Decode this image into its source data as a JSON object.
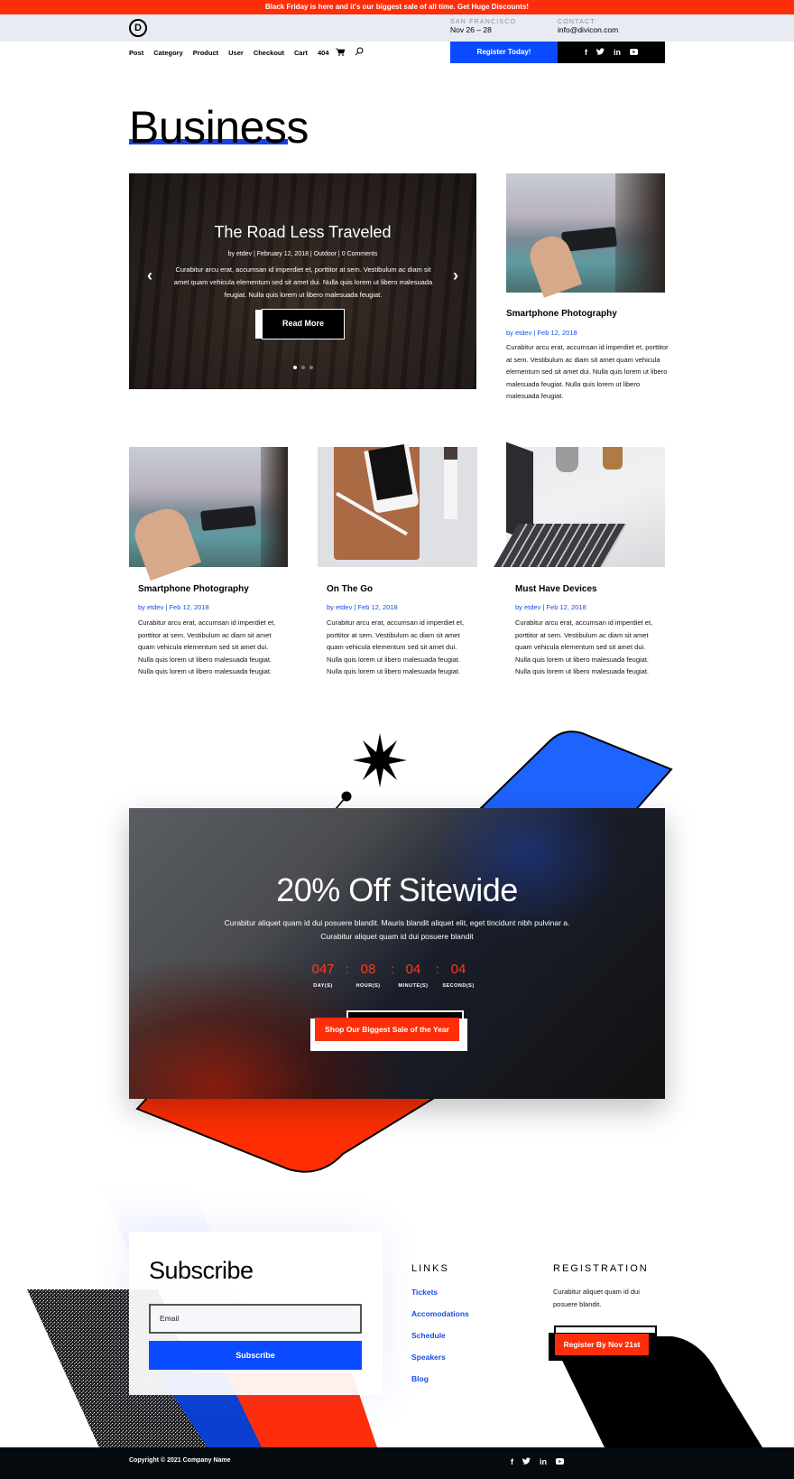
{
  "promo_bar": {
    "text": "Black Friday is here and it's our biggest sale of all time. Get Huge Discounts!"
  },
  "header": {
    "logo_letter": "D",
    "location_label": "SAN FRANCISCO",
    "location_value": "Nov 26 – 28",
    "contact_label": "CONTACT",
    "contact_value": "info@divicon.com",
    "nav": [
      "Post",
      "Category",
      "Product",
      "User",
      "Checkout",
      "Cart",
      "404"
    ],
    "register_label": "Register Today!",
    "social": [
      "f",
      "t",
      "in",
      "▶"
    ]
  },
  "page_title": "Business",
  "slider": {
    "title": "The Road Less Traveled",
    "meta": "by etdev | February 12, 2018 | Outdoor | 0 Comments",
    "text": "Curabitur arcu erat, accumsan id imperdiet et, porttitor at sem. Vestibulum ac diam sit amet quam vehicula elementum sed sit amet dui. Nulla quis lorem ut libero malesuada feugiat. Nulla quis lorem ut libero malesuada feugiat.",
    "button": "Read More",
    "prev": "‹",
    "next": "›",
    "active_slide": 1,
    "slide_count": 3
  },
  "featured_post": {
    "title": "Smartphone Photography",
    "meta": "by etdev | Feb 12, 2018",
    "text": "Curabitur arcu erat, accumsan id imperdiet et, porttitor at sem. Vestibulum ac diam sit amet quam vehicula elementum sed sit amet dui. Nulla quis lorem ut libero malesuada feugiat. Nulla quis lorem ut libero malesuada feugiat."
  },
  "posts": [
    {
      "title": "Smartphone Photography",
      "meta": "by etdev | Feb 12, 2018",
      "text": "Curabitur arcu erat, accumsan id imperdiet et, porttitor at sem. Vestibulum ac diam sit amet quam vehicula elementum sed sit amet dui. Nulla quis lorem ut libero malesuada feugiat. Nulla quis lorem ut libero malesuada feugiat."
    },
    {
      "title": "On The Go",
      "meta": "by etdev | Feb 12, 2018",
      "text": "Curabitur arcu erat, accumsan id imperdiet et, porttitor at sem. Vestibulum ac diam sit amet quam vehicula elementum sed sit amet dui. Nulla quis lorem ut libero malesuada feugiat. Nulla quis lorem ut libero malesuada feugiat."
    },
    {
      "title": "Must Have Devices",
      "meta": "by etdev | Feb 12, 2018",
      "text": "Curabitur arcu erat, accumsan id imperdiet et, porttitor at sem. Vestibulum ac diam sit amet quam vehicula elementum sed sit amet dui. Nulla quis lorem ut libero malesuada feugiat. Nulla quis lorem ut libero malesuada feugiat."
    }
  ],
  "sale": {
    "title": "20% Off Sitewide",
    "text": "Curabitur aliquet quam id dui posuere blandit. Mauris blandit aliquet elit, eget tincidunt nibh pulvinar a. Curabitur aliquet quam id dui posuere blandit",
    "countdown": [
      {
        "value": "047",
        "label": "DAY(S)"
      },
      {
        "value": "08",
        "label": "HOUR(S)"
      },
      {
        "value": "04",
        "label": "MINUTE(S)"
      },
      {
        "value": "04",
        "label": "SECOND(S)"
      }
    ],
    "separator": ":",
    "button": "Shop Our Biggest Sale of the Year"
  },
  "subscribe": {
    "title": "Subscribe",
    "email_placeholder": "Email",
    "button": "Subscribe"
  },
  "links": {
    "heading": "LINKS",
    "items": [
      "Tickets",
      "Accomodations",
      "Schedule",
      "Speakers",
      "Blog"
    ]
  },
  "registration": {
    "heading": "REGISTRATION",
    "text": "Curabitur aliquet quam id dui posuere blandit.",
    "button": "Register By Nov 21st"
  },
  "footer": {
    "copyright": "Copyright © 2021 Company Name",
    "social": [
      "f",
      "t",
      "in",
      "▶"
    ]
  },
  "colors": {
    "accent_red": "#ff2e0a",
    "accent_blue": "#0a4bff",
    "link_blue": "#1a4fe0"
  }
}
